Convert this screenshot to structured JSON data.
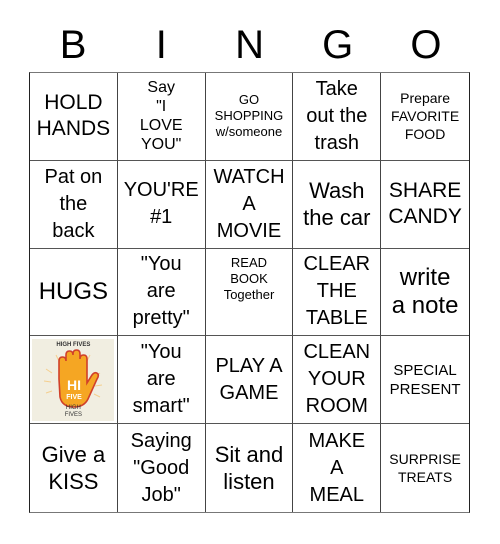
{
  "header": {
    "letters": [
      "B",
      "I",
      "N",
      "G",
      "O"
    ]
  },
  "cells": [
    {
      "text": "HOLD\nHANDS"
    },
    {
      "text": "Say\n\"I\nLOVE\nYOU\""
    },
    {
      "text": "GO\nSHOPPING\nw/someone"
    },
    {
      "text": "Take\nout the\ntrash"
    },
    {
      "text": "Prepare\nFAVORITE\nFOOD"
    },
    {
      "text": "Pat on\nthe\nback"
    },
    {
      "text": "YOU'RE\n#1"
    },
    {
      "text": "WATCH\nA\nMOVIE"
    },
    {
      "text": "Wash\nthe car"
    },
    {
      "text": "SHARE\nCANDY"
    },
    {
      "text": "HUGS"
    },
    {
      "text": "\"You\nare\npretty\""
    },
    {
      "text": "READ\nBOOK\nTogether"
    },
    {
      "text": "CLEAR\nTHE\nTABLE"
    },
    {
      "text": "write\na note"
    },
    {
      "image": "high-five-hand",
      "caption_top": "HIGH FIVES",
      "hand_text_1": "HI",
      "hand_text_2": "FIVE",
      "caption_bottom": "HIGH\nFIVES",
      "colors": {
        "hand": "#f5a623",
        "outline": "#d0402a",
        "background": "#f1eee1"
      }
    },
    {
      "text": "\"You\nare\nsmart\""
    },
    {
      "text": "PLAY A\nGAME"
    },
    {
      "text": "CLEAN\nYOUR\nROOM"
    },
    {
      "text": "SPECIAL\nPRESENT"
    },
    {
      "text": "Give a\nKISS"
    },
    {
      "text": "Saying\n\"Good\nJob\""
    },
    {
      "text": "Sit and\nlisten"
    },
    {
      "text": "MAKE\nA\nMEAL"
    },
    {
      "text": "SURPRISE\nTREATS"
    }
  ]
}
